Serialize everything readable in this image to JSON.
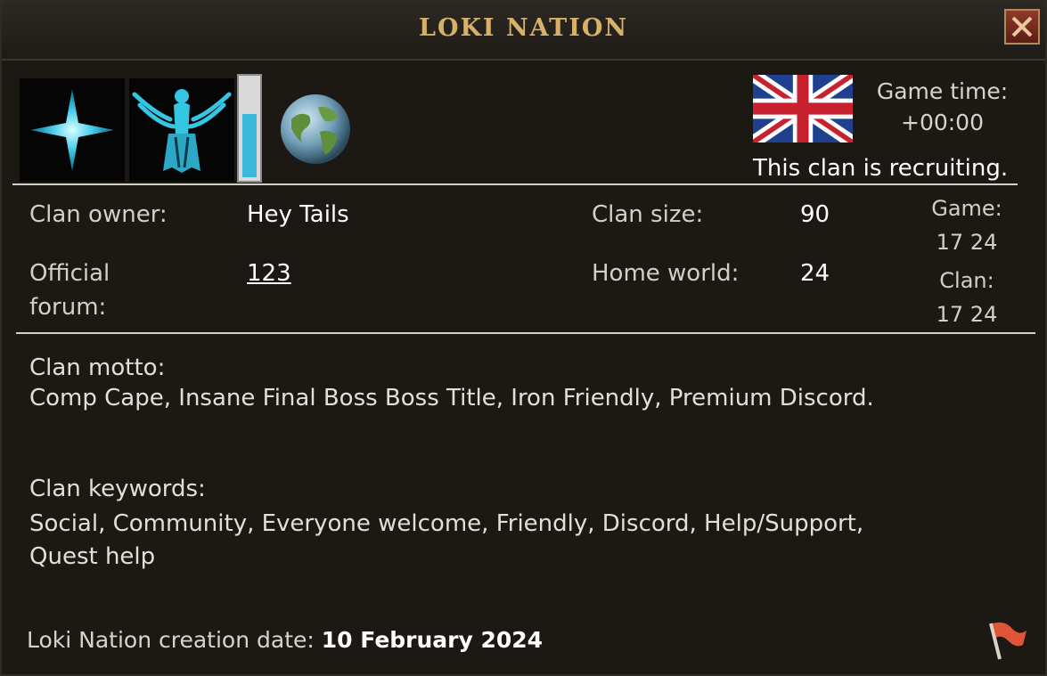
{
  "window": {
    "title": "LOKI NATION"
  },
  "header": {
    "game_time_label": "Game time:",
    "game_time_value": "+00:00",
    "recruiting_text": "This clan is recruiting.",
    "meter_fill": 0.65,
    "flag": "united-kingdom-flag"
  },
  "info": {
    "owner_label": "Clan owner:",
    "owner_value": "Hey Tails",
    "forum_label_line1": "Official",
    "forum_label_line2": "forum:",
    "forum_value": "123",
    "size_label": "Clan size:",
    "size_value": "90",
    "home_world_label": "Home world:",
    "home_world_value": "24",
    "game_label": "Game:",
    "game_value": "17 24",
    "clan_label": "Clan:",
    "clan_value": "17 24"
  },
  "motto": {
    "label": "Clan motto:",
    "text": "Comp Cape, Insane Final Boss Boss Title, Iron Friendly, Premium Discord."
  },
  "keywords": {
    "label": "Clan keywords:",
    "line1": "Social, Community, Everyone welcome, Friendly, Discord, Help/Support,",
    "line2": "Quest help"
  },
  "footer": {
    "creation_prefix": "Loki Nation creation date: ",
    "creation_date": "10 February 2024"
  },
  "colors": {
    "title": "#d7b06a",
    "accent_cyan": "#3bb9d9",
    "close_red": "#8e3a2a",
    "report_flag": "#e0553a"
  }
}
